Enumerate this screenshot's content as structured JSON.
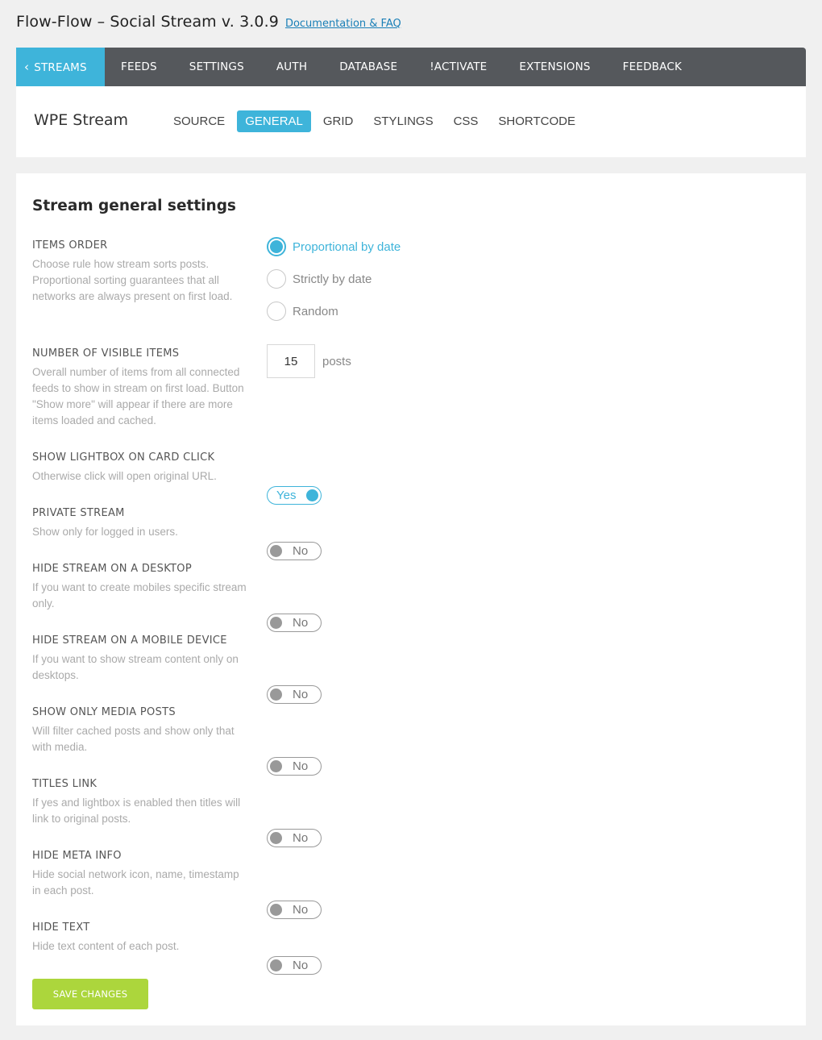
{
  "header": {
    "title": "Flow-Flow – Social Stream v. 3.0.9",
    "doc_link": "Documentation & FAQ"
  },
  "main_nav": {
    "back_icon": "chevron-left-icon",
    "items": [
      {
        "label": "STREAMS",
        "active": true
      },
      {
        "label": "FEEDS"
      },
      {
        "label": "SETTINGS"
      },
      {
        "label": "AUTH"
      },
      {
        "label": "DATABASE"
      },
      {
        "label": "!ACTIVATE"
      },
      {
        "label": "EXTENSIONS"
      },
      {
        "label": "FEEDBACK"
      }
    ]
  },
  "stream": {
    "name": "WPE Stream",
    "tabs": [
      {
        "label": "SOURCE"
      },
      {
        "label": "GENERAL",
        "active": true
      },
      {
        "label": "GRID"
      },
      {
        "label": "STYLINGS"
      },
      {
        "label": "CSS"
      },
      {
        "label": "SHORTCODE"
      }
    ]
  },
  "panel": {
    "title": "Stream general settings",
    "items_order": {
      "label": "ITEMS ORDER",
      "desc": "Choose rule how stream sorts posts. Proportional sorting guarantees that all networks are always present on first load.",
      "options": [
        "Proportional by date",
        "Strictly by date",
        "Random"
      ],
      "selected": "Proportional by date"
    },
    "visible_items": {
      "label": "NUMBER OF VISIBLE ITEMS",
      "desc": "Overall number of items from all connected feeds to show in stream on first load. Button \"Show more\" will appear if there are more items loaded and cached.",
      "value": "15",
      "unit": "posts"
    },
    "toggles": [
      {
        "label": "SHOW LIGHTBOX ON CARD CLICK",
        "desc": "Otherwise click will open original URL.",
        "value": "Yes"
      },
      {
        "label": "PRIVATE STREAM",
        "desc": "Show only for logged in users.",
        "value": "No"
      },
      {
        "label": "HIDE STREAM ON A DESKTOP",
        "desc": "If you want to create mobiles specific stream only.",
        "value": "No"
      },
      {
        "label": "HIDE STREAM ON A MOBILE DEVICE",
        "desc": "If you want to show stream content only on desktops.",
        "value": "No"
      },
      {
        "label": "SHOW ONLY MEDIA POSTS",
        "desc": "Will filter cached posts and show only that with media.",
        "value": "No"
      },
      {
        "label": "TITLES LINK",
        "desc": "If yes and lightbox is enabled then titles will link to original posts.",
        "value": "No"
      },
      {
        "label": "HIDE META INFO",
        "desc": "Hide social network icon, name, timestamp in each post.",
        "value": "No"
      },
      {
        "label": "HIDE TEXT",
        "desc": "Hide text content of each post.",
        "value": "No"
      }
    ],
    "save_label": "SAVE CHANGES"
  },
  "colors": {
    "accent": "#3eb4da",
    "nav_bg": "#55585c",
    "save_bg": "#acd63c",
    "page_bg": "#f0f0f0"
  }
}
